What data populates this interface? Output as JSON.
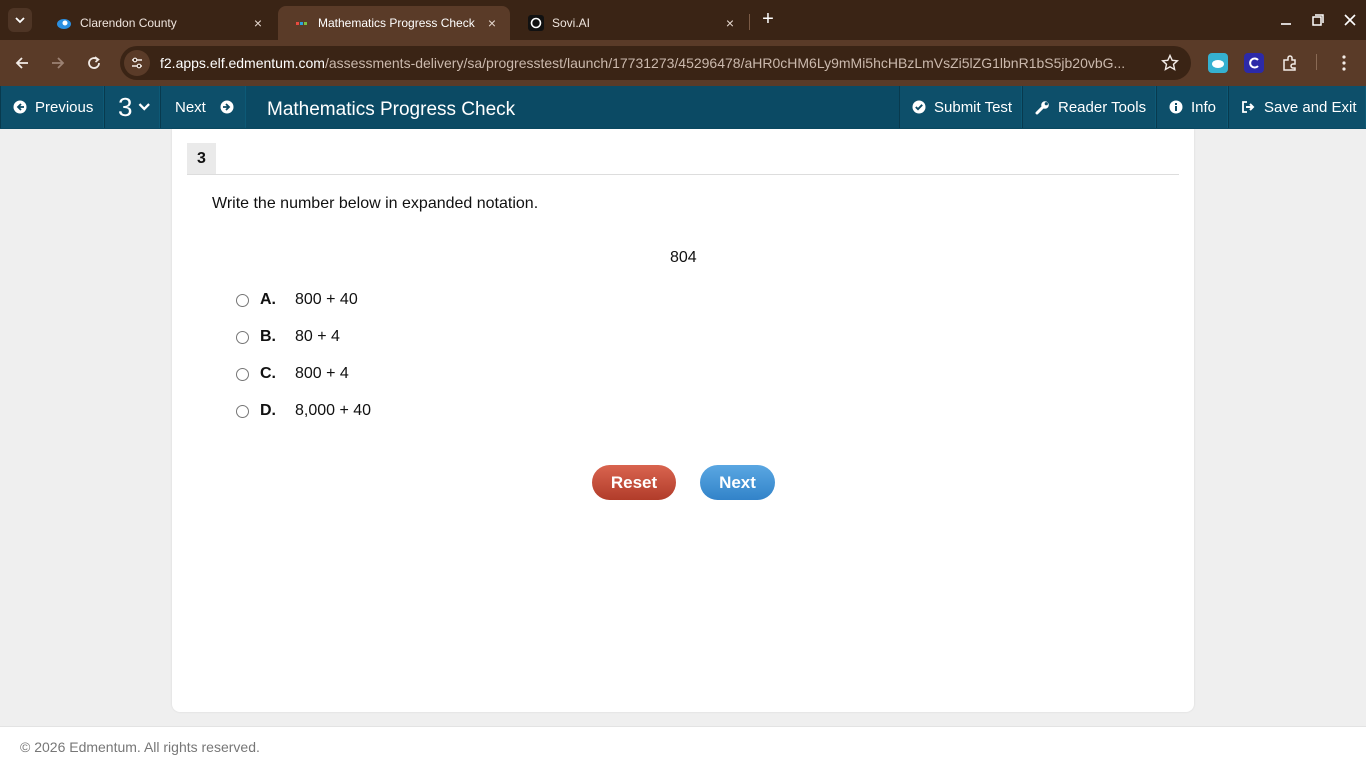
{
  "browser": {
    "tabs": [
      {
        "title": "Clarendon County",
        "favicon": "cloud-icon",
        "active": false
      },
      {
        "title": "Mathematics Progress Check",
        "favicon": "edmentum-icon",
        "active": true
      },
      {
        "title": "Sovi.AI",
        "favicon": "sovi-icon",
        "active": false
      }
    ],
    "close_glyph": "×",
    "new_tab_glyph": "+",
    "url_host": "f2.apps.elf.edmentum.com",
    "url_path": "/assessments-delivery/sa/progresstest/launch/17731273/45296478/aHR0cHM6Ly9mMi5hcHBzLmVsZi5lZG1lbnR1bS5jb20vbG..."
  },
  "header": {
    "previous_label": "Previous",
    "question_number": "3",
    "next_label": "Next",
    "title": "Mathematics Progress Check",
    "submit_label": "Submit Test",
    "reader_tools_label": "Reader Tools",
    "info_label": "Info",
    "save_exit_label": "Save and Exit"
  },
  "question": {
    "number": "3",
    "prompt": "Write the number below in expanded notation.",
    "value": "804",
    "options": [
      {
        "letter": "A.",
        "text": "800 + 40"
      },
      {
        "letter": "B.",
        "text": "80 + 4"
      },
      {
        "letter": "C.",
        "text": "800 + 4"
      },
      {
        "letter": "D.",
        "text": "8,000 + 40"
      }
    ]
  },
  "actions": {
    "reset_label": "Reset",
    "next_label": "Next"
  },
  "footer": {
    "copyright": "© 2026 Edmentum. All rights reserved."
  },
  "colors": {
    "tabstrip": "#3a2415",
    "toolbar": "#5a3b28",
    "appbar": "#0b4a64",
    "reset": "#c44d39",
    "next": "#4696d8"
  }
}
